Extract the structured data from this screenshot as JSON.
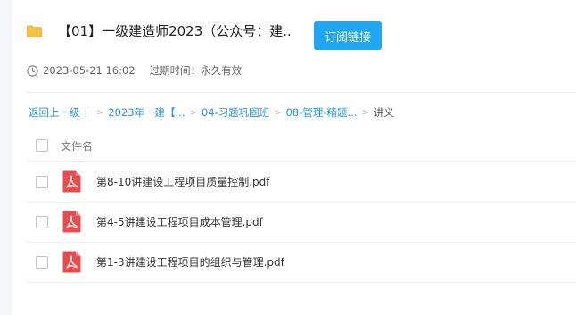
{
  "share": {
    "title": "【01】一级建造师2023（公众号：建...",
    "subscribe_label": "订阅链接",
    "date": "2023-05-21 16:02",
    "expiry": "过期时间：永久有效"
  },
  "breadcrumb": {
    "back_label": "返回上一级",
    "items": [
      "2023年一建【...",
      "04-习题巩固班",
      "08-管理-精题..."
    ],
    "current": "讲义"
  },
  "file_list": {
    "column_header": "文件名",
    "files": [
      {
        "name": "第8-10讲建设工程项目质量控制.pdf",
        "icon": "pdf-icon"
      },
      {
        "name": "第4-5讲建设工程项目成本管理.pdf",
        "icon": "pdf-icon"
      },
      {
        "name": "第1-3讲建设工程项目的组织与管理.pdf",
        "icon": "pdf-icon"
      }
    ]
  },
  "colors": {
    "accent": "#1fa7f1",
    "link": "#2a97d8",
    "folder": "#f5c343",
    "pdf": "#e84c4c"
  }
}
